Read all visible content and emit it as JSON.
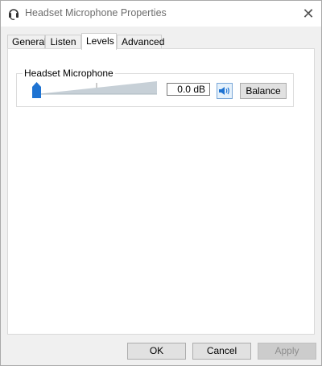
{
  "window": {
    "title": "Headset Microphone Properties",
    "close_glyph": "✕"
  },
  "tabs": [
    {
      "label": "General",
      "active": false
    },
    {
      "label": "Listen",
      "active": false
    },
    {
      "label": "Levels",
      "active": true
    },
    {
      "label": "Advanced",
      "active": false
    }
  ],
  "levels": {
    "device_label": "Headset Microphone",
    "slider_value_fraction": 0.0,
    "level_text": "0.0 dB",
    "mute_icon": "speaker-icon",
    "balance_label": "Balance"
  },
  "footer": {
    "ok_label": "OK",
    "cancel_label": "Cancel",
    "apply_label": "Apply"
  },
  "colors": {
    "accent": "#1e73d2",
    "track": "#c7d0d7"
  }
}
